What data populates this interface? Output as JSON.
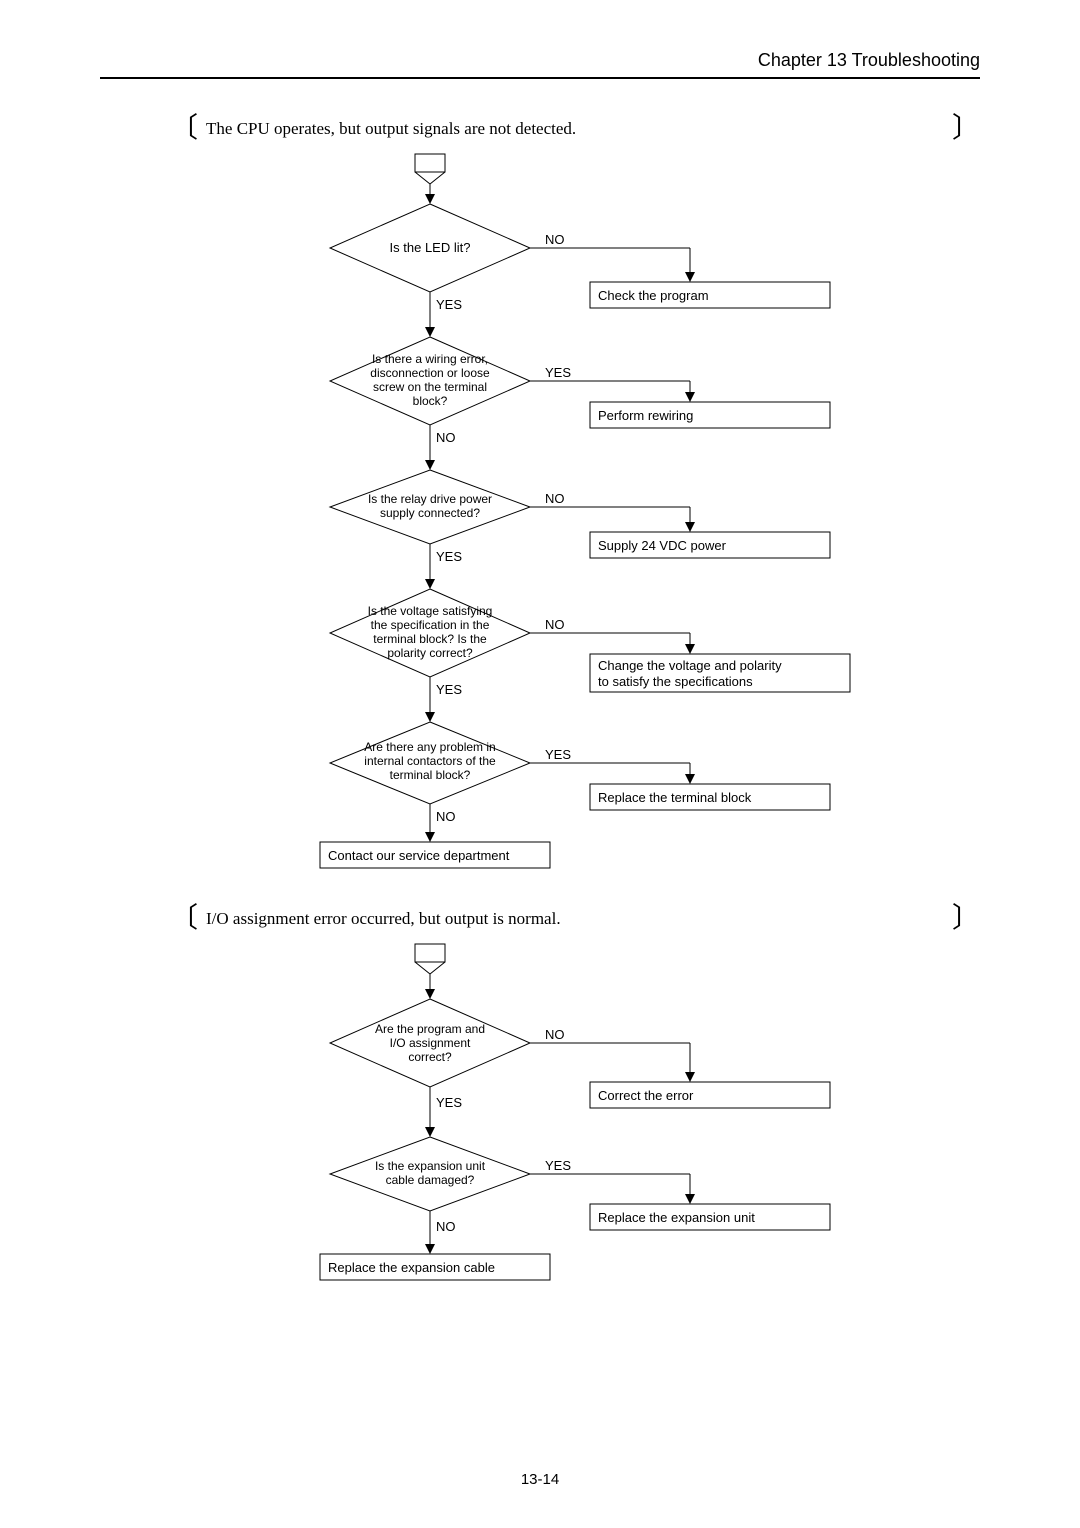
{
  "header": "Chapter 13  Troubleshooting",
  "page_number": "13-14",
  "section1": {
    "title": "The CPU operates, but output signals are not detected.",
    "d1": "Is the LED lit?",
    "d1_no": "NO",
    "d1_yes": "YES",
    "a1": "Check the program",
    "d2l1": "Is there a wiring error,",
    "d2l2": "disconnection or loose",
    "d2l3": "screw on the terminal",
    "d2l4": "block?",
    "d2_yes": "YES",
    "d2_no": "NO",
    "a2": "Perform rewiring",
    "d3l1": "Is the relay drive power",
    "d3l2": "supply connected?",
    "d3_no": "NO",
    "d3_yes": "YES",
    "a3": "Supply 24 VDC power",
    "d4l1": "Is the voltage satisfying",
    "d4l2": "the specification in the",
    "d4l3": "terminal block? Is the",
    "d4l4": "polarity correct?",
    "d4_no": "NO",
    "d4_yes": "YES",
    "a4l1": "Change the voltage and polarity",
    "a4l2": "to satisfy the specifications",
    "d5l1": "Are there any problem in",
    "d5l2": "internal contactors of the",
    "d5l3": "terminal block?",
    "d5_yes": "YES",
    "d5_no": "NO",
    "a5": "Replace the terminal block",
    "a6": "Contact our service department"
  },
  "section2": {
    "title": "I/O assignment error occurred, but output is normal.",
    "d1l1": "Are the program and",
    "d1l2": "I/O assignment",
    "d1l3": "correct?",
    "d1_no": "NO",
    "d1_yes": "YES",
    "a1": "Correct the error",
    "d2l1": "Is the expansion unit",
    "d2l2": "cable damaged?",
    "d2_yes": "YES",
    "d2_no": "NO",
    "a2": "Replace the expansion unit",
    "a3": "Replace the expansion cable"
  }
}
